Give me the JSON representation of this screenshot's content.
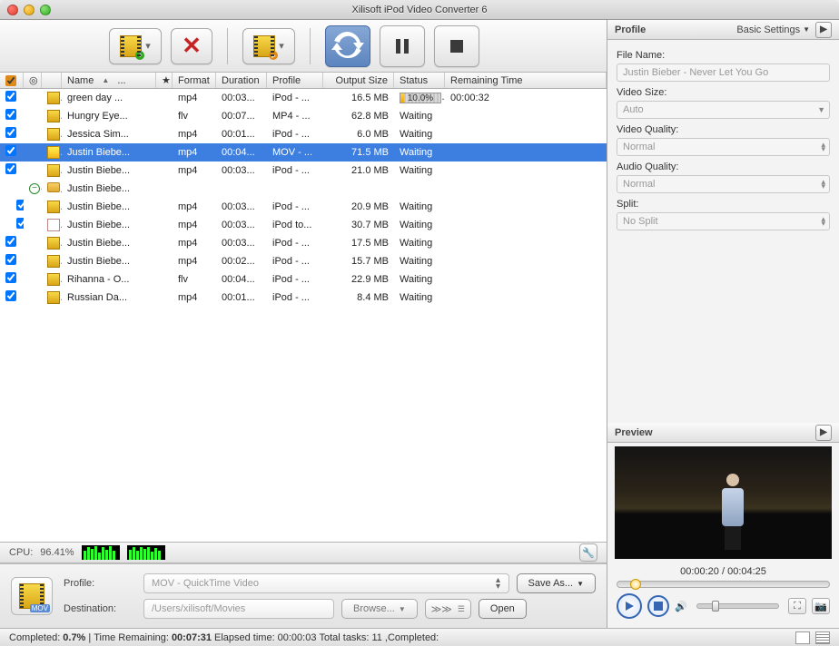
{
  "window": {
    "title": "Xilisoft iPod Video Converter 6"
  },
  "toolbar": {},
  "columns": {
    "name": "Name",
    "star": "★",
    "format": "Format",
    "duration": "Duration",
    "profile": "Profile",
    "output": "Output Size",
    "status": "Status",
    "remaining": "Remaining Time",
    "sort_indicator": "▲",
    "name_trunc": "..."
  },
  "rows": [
    {
      "ck": true,
      "icon": "film",
      "name": "green day ...",
      "fmt": "mp4",
      "dur": "00:03...",
      "prof": "iPod - ...",
      "out": "16.5 MB",
      "status_type": "progress",
      "pct": "10.0%",
      "pct_w": 10,
      "rem": "00:00:32"
    },
    {
      "ck": true,
      "icon": "film",
      "name": "Hungry Eye...",
      "fmt": "flv",
      "dur": "00:07...",
      "prof": "MP4 - ...",
      "out": "62.8 MB",
      "status": "Waiting"
    },
    {
      "ck": true,
      "icon": "film",
      "name": "Jessica Sim...",
      "fmt": "mp4",
      "dur": "00:01...",
      "prof": "iPod - ...",
      "out": "6.0 MB",
      "status": "Waiting"
    },
    {
      "ck": true,
      "icon": "film",
      "name": "Justin Biebe...",
      "fmt": "mp4",
      "dur": "00:04...",
      "prof": "MOV - ...",
      "out": "71.5 MB",
      "status": "Waiting",
      "sel": true
    },
    {
      "ck": true,
      "icon": "film",
      "name": "Justin Biebe...",
      "fmt": "mp4",
      "dur": "00:03...",
      "prof": "iPod - ...",
      "out": "21.0 MB",
      "status": "Waiting"
    },
    {
      "ck": false,
      "icon": "folder",
      "name": "Justin Biebe...",
      "fmt": "",
      "dur": "",
      "prof": "",
      "out": "",
      "status": "",
      "expander": true
    },
    {
      "ck": true,
      "icon": "film",
      "name": "Justin Biebe...",
      "fmt": "mp4",
      "dur": "00:03...",
      "prof": "iPod - ...",
      "out": "20.9 MB",
      "status": "Waiting",
      "indent": true
    },
    {
      "ck": true,
      "icon": "doc",
      "name": "Justin Biebe...",
      "fmt": "mp4",
      "dur": "00:03...",
      "prof": "iPod to...",
      "out": "30.7 MB",
      "status": "Waiting",
      "indent": true
    },
    {
      "ck": true,
      "icon": "film",
      "name": "Justin Biebe...",
      "fmt": "mp4",
      "dur": "00:03...",
      "prof": "iPod - ...",
      "out": "17.5 MB",
      "status": "Waiting"
    },
    {
      "ck": true,
      "icon": "film",
      "name": "Justin Biebe...",
      "fmt": "mp4",
      "dur": "00:02...",
      "prof": "iPod - ...",
      "out": "15.7 MB",
      "status": "Waiting"
    },
    {
      "ck": true,
      "icon": "film",
      "name": "Rihanna - O...",
      "fmt": "flv",
      "dur": "00:04...",
      "prof": "iPod - ...",
      "out": "22.9 MB",
      "status": "Waiting"
    },
    {
      "ck": true,
      "icon": "film",
      "name": "Russian Da...",
      "fmt": "mp4",
      "dur": "00:01...",
      "prof": "iPod - ...",
      "out": "8.4 MB",
      "status": "Waiting"
    }
  ],
  "cpu": {
    "label": "CPU:",
    "value": "96.41%"
  },
  "bottom": {
    "profile_label": "Profile:",
    "profile_value": "MOV - QuickTime Video",
    "dest_label": "Destination:",
    "dest_value": "/Users/xilisoft/Movies",
    "save_as": "Save As...",
    "browse": "Browse...",
    "open": "Open",
    "skip": "≫≫"
  },
  "status": {
    "completed_lbl": "Completed: ",
    "completed_val": "0.7%",
    "sep1": " | ",
    "tr_lbl": "Time Remaining: ",
    "tr_val": "00:07:31",
    "el_lbl": " Elapsed time: ",
    "el_val": "00:00:03",
    "tt_lbl": " Total tasks: ",
    "tt_val": " 11 ",
    "cm_lbl": ",Completed:"
  },
  "right": {
    "profile_header": "Profile",
    "basic": "Basic Settings",
    "filename_lbl": "File Name:",
    "filename_val": "Justin Bieber - Never Let You Go",
    "vsize_lbl": "Video Size:",
    "vsize_val": "Auto",
    "vqual_lbl": "Video Quality:",
    "vqual_val": "Normal",
    "aqual_lbl": "Audio Quality:",
    "aqual_val": "Normal",
    "split_lbl": "Split:",
    "split_val": "No Split",
    "preview_header": "Preview",
    "time": "00:00:20 / 00:04:25"
  }
}
